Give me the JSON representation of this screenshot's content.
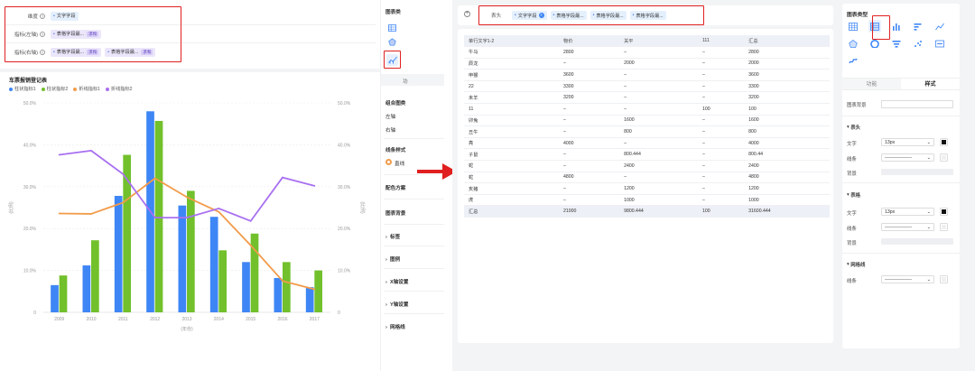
{
  "left": {
    "fields": [
      {
        "label": "维度",
        "chips": [
          {
            "text": "文字字段",
            "agg": ""
          }
        ]
      },
      {
        "label": "指标(左轴)",
        "chips": [
          {
            "text": "表格字段最...",
            "agg": "求和"
          }
        ]
      },
      {
        "label": "指标(右轴)",
        "chips": [
          {
            "text": "表格字段最...",
            "agg": "求和"
          },
          {
            "text": "表格字段最...",
            "agg": "求和"
          }
        ]
      }
    ]
  },
  "chart_title": "车票报销登记表",
  "chart_data": {
    "type": "bar",
    "categories": [
      "2009",
      "2010",
      "2011",
      "2012",
      "2013",
      "2014",
      "2015",
      "2016",
      "2017"
    ],
    "series": [
      {
        "name": "柱状指标1",
        "kind": "bar",
        "axis": "left",
        "color": "#3e86f5",
        "values": [
          6.5,
          11.2,
          27.8,
          48.0,
          25.5,
          22.8,
          12.0,
          8.2,
          6.0
        ]
      },
      {
        "name": "柱状指标2",
        "kind": "bar",
        "axis": "left",
        "color": "#72c02c",
        "values": [
          8.8,
          17.2,
          37.6,
          45.7,
          29.0,
          14.8,
          18.8,
          12.0,
          10.0
        ]
      },
      {
        "name": "折线指标1",
        "kind": "line",
        "axis": "right",
        "color": "#f29b4a",
        "values": [
          23.6,
          23.5,
          26.2,
          32.0,
          27.5,
          24.0,
          16.0,
          7.5,
          5.5
        ]
      },
      {
        "name": "折线指标2",
        "kind": "line",
        "axis": "right",
        "color": "#a870f0",
        "values": [
          37.6,
          38.6,
          33.0,
          22.6,
          22.6,
          24.8,
          21.8,
          32.2,
          30.2
        ]
      }
    ],
    "left_ticks": [
      "0",
      "10.0%",
      "20.0%",
      "30.0%",
      "40.0%",
      "50.0%"
    ],
    "right_ticks": [
      "0",
      "10.0%",
      "20.0%",
      "30.0%",
      "40.0%",
      "50.0%"
    ],
    "ylim": [
      0,
      50
    ],
    "xlabel": "(年份)",
    "ylabel_left": "(比例)",
    "ylabel_right": "(比例)",
    "legend_position": "top-left",
    "grid": true
  },
  "left_side": {
    "chart_type_label": "图表类",
    "func_label": "功",
    "combo_label": "组合图类",
    "left_axis": "左轴",
    "right_axis": "右轴",
    "line_style": "线条样式",
    "line_style_opt": "直线",
    "color_scheme": "配色方案",
    "chart_bg": "图表背景",
    "sections": [
      "标签",
      "图例",
      "X轴设置",
      "Y轴设置",
      "网格线"
    ]
  },
  "right": {
    "header_label": "表头",
    "header_chips": [
      "文字字段",
      "表格字段最...",
      "表格字段最...",
      "表格字段最..."
    ],
    "table": {
      "columns": [
        "单行文字1-2",
        "物价",
        "关平",
        "111",
        "汇总"
      ],
      "rows": [
        [
          "午马",
          "2800",
          "–",
          "–",
          "2800"
        ],
        [
          "辰龙",
          "–",
          "2000",
          "–",
          "2000"
        ],
        [
          "申猴",
          "3600",
          "–",
          "–",
          "3600"
        ],
        [
          "22",
          "3300",
          "–",
          "–",
          "3300"
        ],
        [
          "未羊",
          "3200",
          "–",
          "–",
          "3200"
        ],
        [
          "11",
          "–",
          "–",
          "100",
          "100"
        ],
        [
          "卯兔",
          "–",
          "1600",
          "–",
          "1600"
        ],
        [
          "丑牛",
          "–",
          "800",
          "–",
          "800"
        ],
        [
          "亮",
          "4000",
          "–",
          "–",
          "4000"
        ],
        [
          "子鼠",
          "–",
          "800.444",
          "–",
          "800.44"
        ],
        [
          "蛇",
          "–",
          "2400",
          "–",
          "2400"
        ],
        [
          "蛇",
          "4800",
          "–",
          "–",
          "4800"
        ],
        [
          "亥猪",
          "–",
          "1200",
          "–",
          "1200"
        ],
        [
          "虎",
          "–",
          "1000",
          "–",
          "1000"
        ]
      ],
      "total": [
        "汇总",
        "21000",
        "9800.444",
        "100",
        "31600.444"
      ]
    },
    "panel": {
      "chart_type_label": "图表类型",
      "tabs": [
        "功能",
        "样式"
      ],
      "bg_label": "图表背景",
      "sec_header": "表头",
      "sec_table": "表格",
      "sec_grid": "网格线",
      "text_label": "文字",
      "line_label": "线条",
      "bg_row_label": "背景",
      "font_size": "13px"
    }
  },
  "colors": {
    "red_highlight": "#e02020",
    "arrow": "#e02020",
    "accent": "#3e86f5"
  }
}
